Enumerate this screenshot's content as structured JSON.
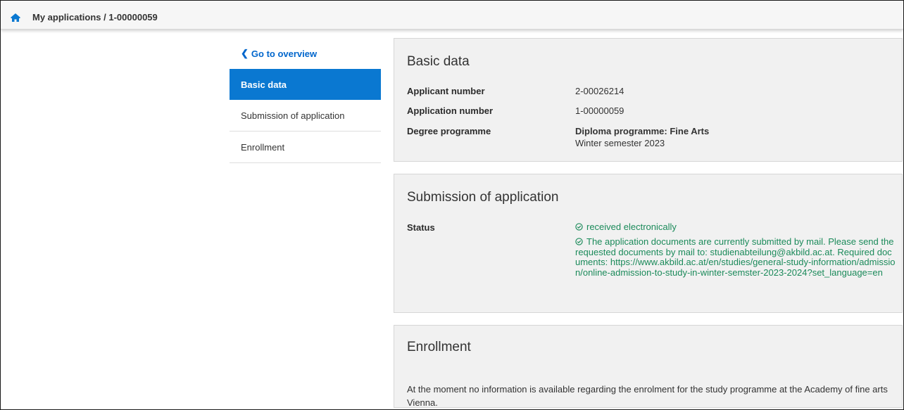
{
  "header": {
    "breadcrumb": "My applications / 1-00000059",
    "home_icon": "home-icon"
  },
  "sidebar": {
    "back_label": "Go to overview",
    "items": [
      {
        "label": "Basic data",
        "active": true
      },
      {
        "label": "Submission of application",
        "active": false
      },
      {
        "label": "Enrollment",
        "active": false
      }
    ]
  },
  "basic_data": {
    "title": "Basic data",
    "applicant_number_label": "Applicant number",
    "applicant_number": "2-00026214",
    "application_number_label": "Application number",
    "application_number": "1-00000059",
    "degree_programme_label": "Degree programme",
    "degree_programme": "Diploma programme: Fine Arts",
    "semester": "Winter semester 2023"
  },
  "submission": {
    "title": "Submission of application",
    "status_label": "Status",
    "status_received": "received electronically",
    "status_message": "The application documents are currently submitted by mail. Please send the requested documents by mail to: studienabteilung@akbild.ac.at. Required documents: https://www.akbild.ac.at/en/studies/general-study-information/admission/online-admission-to-study-in-winter-semster-2023-2024?set_language=en"
  },
  "enrollment": {
    "title": "Enrollment",
    "message": "At the moment no information is available regarding the enrolment for the study programme at the Academy of fine arts Vienna."
  },
  "colors": {
    "accent": "#0a78d1",
    "link": "#0066cc",
    "success": "#1b8a5a",
    "panel_bg": "#f1f1f1"
  }
}
